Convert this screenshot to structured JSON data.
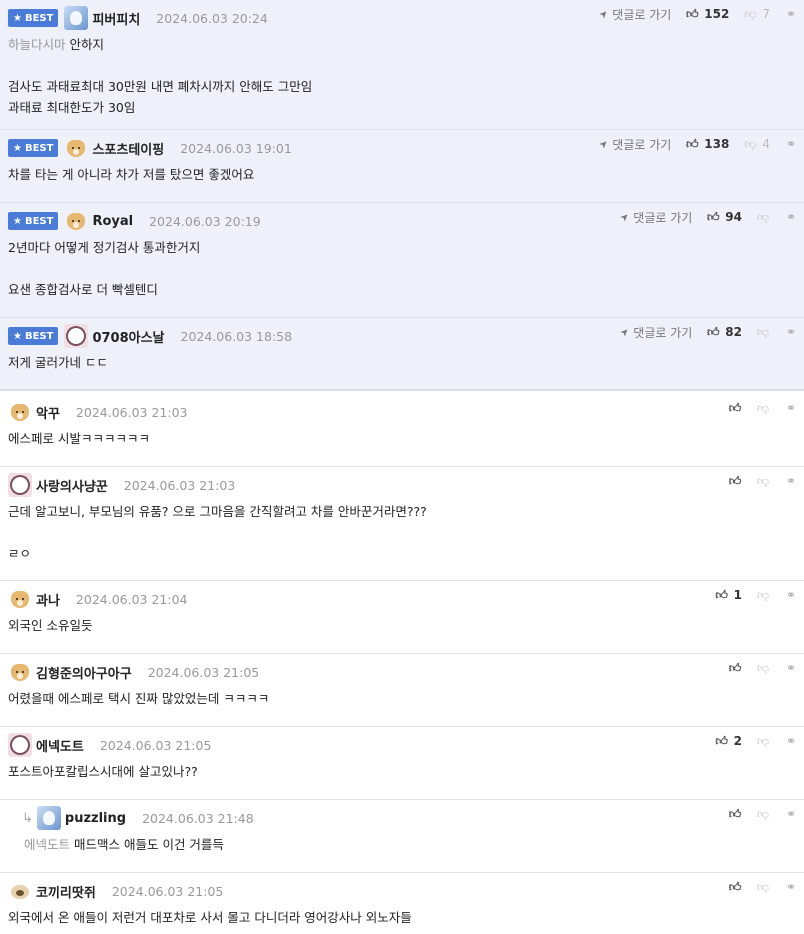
{
  "labels": {
    "best": "BEST",
    "goto": "댓글로 가기"
  },
  "comments": [
    {
      "best": true,
      "nick": "피버피치",
      "date": "2024.06.03 20:24",
      "avatar": "blue",
      "ref": "하늘다시마",
      "lines": [
        "안하지",
        "",
        "검사도 과태료최대 30만원 내면 폐차시까지 안해도 그만임",
        "과태료 최대한도가 30임"
      ],
      "likes": "152",
      "dislikes": "7",
      "goto": true
    },
    {
      "best": true,
      "nick": "스포츠테이핑",
      "date": "2024.06.03 19:01",
      "avatar": "dog",
      "ref": "",
      "lines": [
        "차를 타는 게 아니라 차가 저를 탔으면 좋겠어요"
      ],
      "likes": "138",
      "dislikes": "4",
      "goto": true
    },
    {
      "best": true,
      "nick": "Royal",
      "date": "2024.06.03 20:19",
      "avatar": "dog",
      "ref": "",
      "lines": [
        "2년마다 어떻게 정기검사 통과한거지",
        "",
        "요샌 종합검사로 더 빡셀텐디"
      ],
      "likes": "94",
      "dislikes": "",
      "goto": true
    },
    {
      "best": true,
      "nick": "0708아스날",
      "date": "2024.06.03 18:58",
      "avatar": "pink",
      "ref": "",
      "lines": [
        "저게 굴러가네 ㄷㄷ"
      ],
      "likes": "82",
      "dislikes": "",
      "goto": true
    },
    {
      "best": false,
      "nick": "악꾸",
      "date": "2024.06.03 21:03",
      "avatar": "dog",
      "ref": "",
      "lines": [
        "에스페로 시발ㅋㅋㅋㅋㅋㅋ"
      ],
      "likes": "",
      "dislikes": ""
    },
    {
      "best": false,
      "nick": "사랑의사냥꾼",
      "date": "2024.06.03 21:03",
      "avatar": "pink",
      "ref": "",
      "lines": [
        "근데 알고보니, 부모님의 유품? 으로 그마음을 간직할려고 차를 안바꾼거라면???",
        "",
        "ㄹㅇ"
      ],
      "likes": "",
      "dislikes": ""
    },
    {
      "best": false,
      "nick": "과나",
      "date": "2024.06.03 21:04",
      "avatar": "dog",
      "ref": "",
      "lines": [
        "외국인 소유일듯"
      ],
      "likes": "1",
      "dislikes": ""
    },
    {
      "best": false,
      "nick": "김형준의아구아구",
      "date": "2024.06.03 21:05",
      "avatar": "dog",
      "ref": "",
      "lines": [
        "어렸을때 에스페로 택시 진짜 많았었는데 ㅋㅋㅋㅋ"
      ],
      "likes": "",
      "dislikes": ""
    },
    {
      "best": false,
      "nick": "에넥도트",
      "date": "2024.06.03 21:05",
      "avatar": "pink",
      "ref": "",
      "lines": [
        "포스트아포칼립스시대에 살고있나??"
      ],
      "likes": "2",
      "dislikes": ""
    },
    {
      "best": false,
      "reply": true,
      "nick": "puzzling",
      "date": "2024.06.03 21:48",
      "avatar": "blue",
      "ref": "에넥도트",
      "lines": [
        "매드맥스 애들도 이건 거를득"
      ],
      "likes": "",
      "dislikes": ""
    },
    {
      "best": false,
      "nick": "코끼리땃쥐",
      "date": "2024.06.03 21:05",
      "avatar": "pug",
      "ref": "",
      "lines": [
        "외국에서 온 애들이 저런거 대포차로 사서 몰고 다니더라 영어강사나 외노자들"
      ],
      "likes": "",
      "dislikes": ""
    }
  ]
}
